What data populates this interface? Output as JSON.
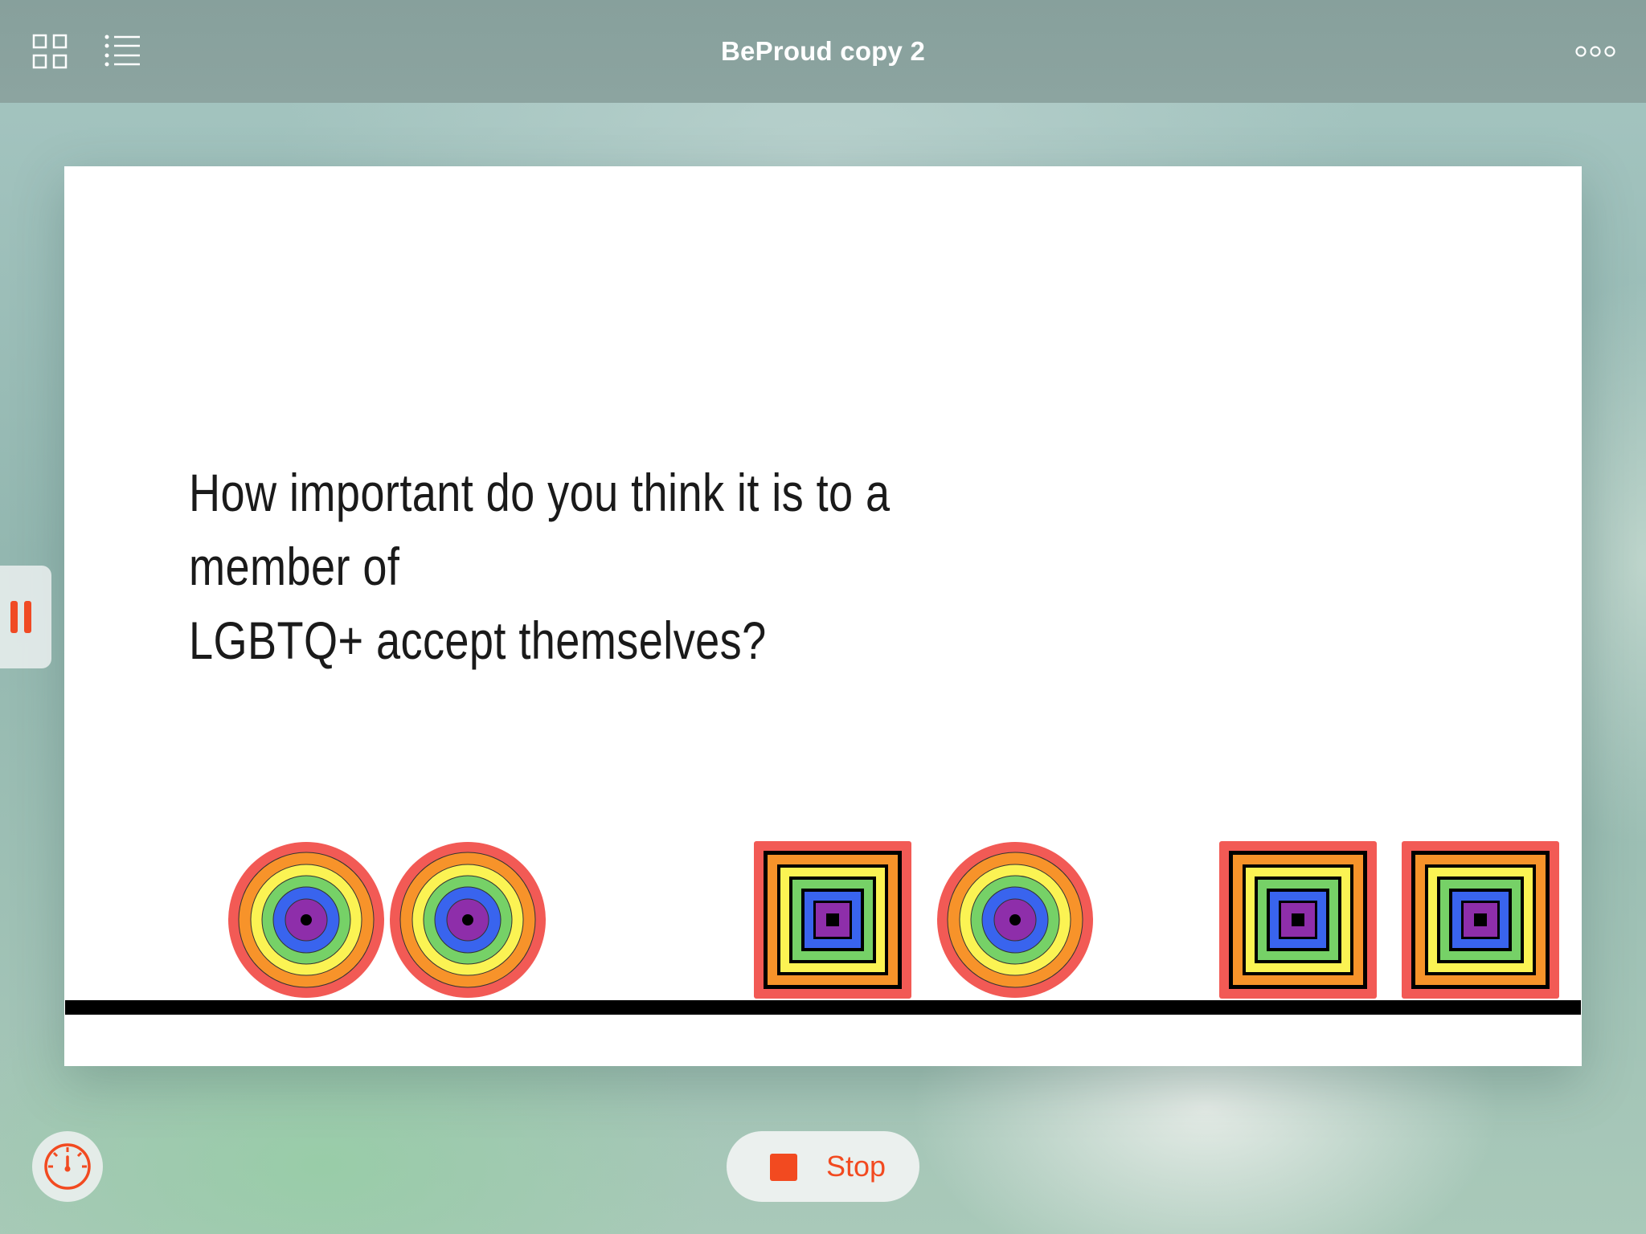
{
  "app": {
    "title": "BeProud copy 2"
  },
  "toolbar": {
    "icons": [
      "grid-icon",
      "list-icon",
      "more-icon"
    ]
  },
  "stage": {
    "question_line_1": "How important do you think it is to a member of",
    "question_line_2": "LGBTQ+ accept themselves?",
    "sprites": [
      "rainbow-circle",
      "rainbow-circle",
      "rainbow-square",
      "rainbow-circle",
      "rainbow-square",
      "rainbow-square"
    ],
    "rainbow_colors": [
      "#f25a55",
      "#f7932a",
      "#fbf353",
      "#76d167",
      "#3964ee",
      "#8e2eaa",
      "#000000"
    ]
  },
  "controls": {
    "stop_label": "Stop",
    "accent_color": "#f24a20"
  }
}
